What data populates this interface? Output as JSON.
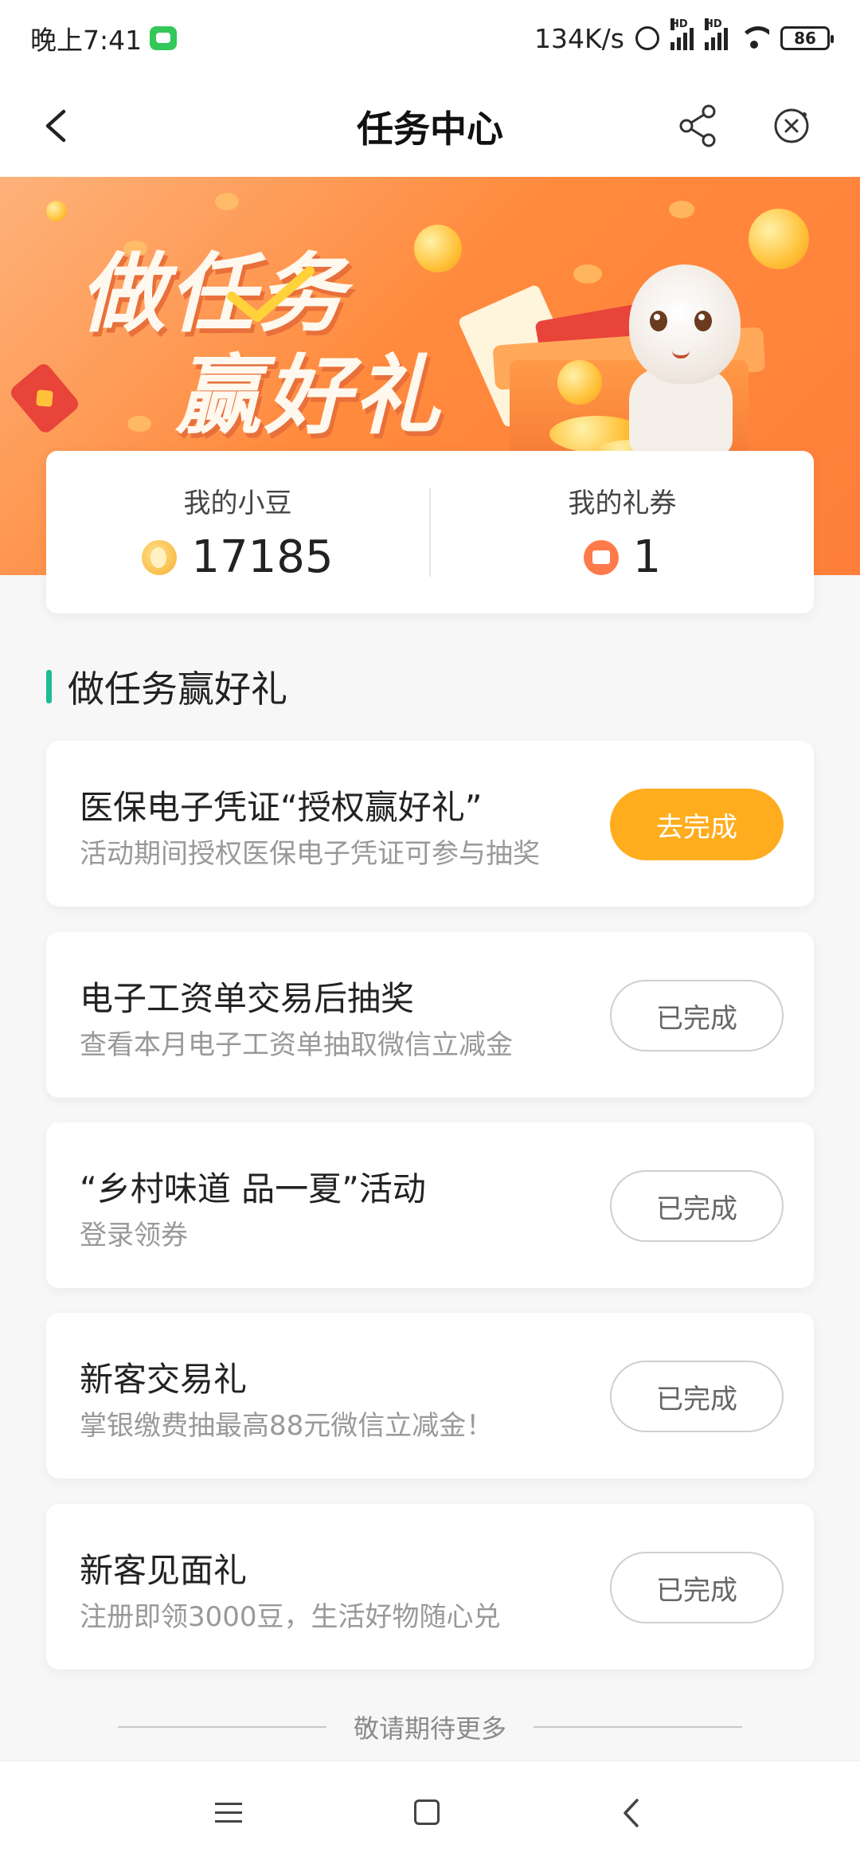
{
  "status_bar": {
    "time": "晚上7:41",
    "network_speed": "134K/s",
    "signal_tag": "HD",
    "battery": "86"
  },
  "nav": {
    "title": "任务中心"
  },
  "banner": {
    "slogan_line1": "做任务",
    "slogan_line2": "赢好礼"
  },
  "assets": {
    "beans_label": "我的小豆",
    "beans_value": "17185",
    "coupons_label": "我的礼券",
    "coupons_value": "1"
  },
  "section": {
    "title": "做任务赢好礼"
  },
  "tasks": [
    {
      "title": "医保电子凭证“授权赢好礼”",
      "desc": "活动期间授权医保电子凭证可参与抽奖",
      "button": "去完成",
      "status": "todo"
    },
    {
      "title": "电子工资单交易后抽奖",
      "desc": "查看本月电子工资单抽取微信立减金",
      "button": "已完成",
      "status": "done"
    },
    {
      "title": "“乡村味道 品一夏”活动",
      "desc": "登录领券",
      "button": "已完成",
      "status": "done"
    },
    {
      "title": "新客交易礼",
      "desc": "掌银缴费抽最高88元微信立减金！",
      "button": "已完成",
      "status": "done"
    },
    {
      "title": "新客见面礼",
      "desc": "注册即领3000豆，生活好物随心兑",
      "button": "已完成",
      "status": "done"
    }
  ],
  "footer": {
    "more_text": "敬请期待更多"
  },
  "colors": {
    "accent_green": "#1cbc94",
    "todo_button": "#ffad1f",
    "banner_orange": "#ff8a3d"
  }
}
